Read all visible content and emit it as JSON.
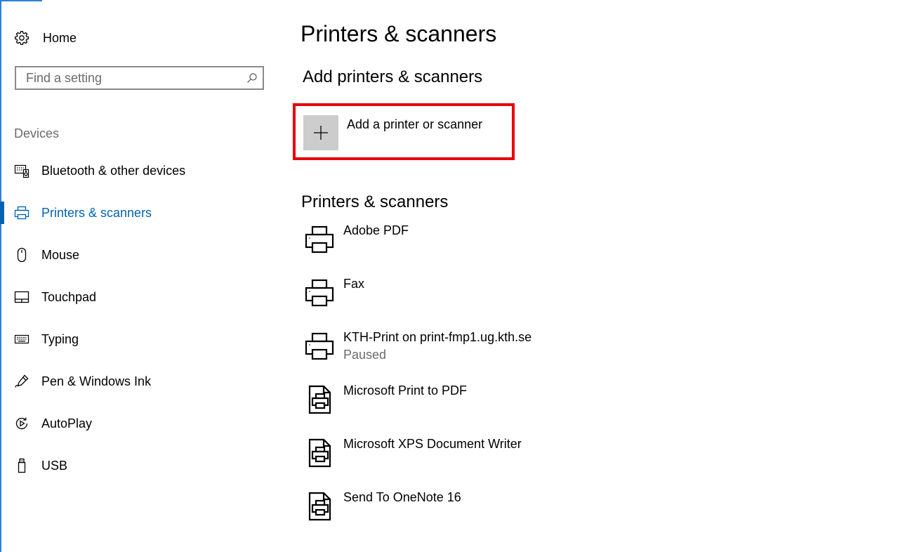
{
  "sidebar": {
    "home_label": "Home",
    "search": {
      "placeholder": "Find a setting"
    },
    "section_label": "Devices",
    "items": [
      {
        "label": "Bluetooth & other devices",
        "icon": "keyboard-speaker-icon"
      },
      {
        "label": "Printers & scanners",
        "icon": "printer-icon",
        "active": true
      },
      {
        "label": "Mouse",
        "icon": "mouse-icon"
      },
      {
        "label": "Touchpad",
        "icon": "touchpad-icon"
      },
      {
        "label": "Typing",
        "icon": "keyboard-icon"
      },
      {
        "label": "Pen & Windows Ink",
        "icon": "pen-icon"
      },
      {
        "label": "AutoPlay",
        "icon": "autoplay-icon"
      },
      {
        "label": "USB",
        "icon": "usb-icon"
      }
    ]
  },
  "main": {
    "title": "Printers & scanners",
    "add_section_title": "Add printers & scanners",
    "add_button_label": "Add a printer or scanner",
    "list_section_title": "Printers & scanners",
    "devices": [
      {
        "name": "Adobe PDF",
        "status": "",
        "icon": "printer-icon"
      },
      {
        "name": "Fax",
        "status": "",
        "icon": "printer-icon"
      },
      {
        "name": "KTH-Print on print-fmp1.ug.kth.se",
        "status": "Paused",
        "icon": "printer-icon"
      },
      {
        "name": "Microsoft Print to PDF",
        "status": "",
        "icon": "document-printer-icon"
      },
      {
        "name": "Microsoft XPS Document Writer",
        "status": "",
        "icon": "document-printer-icon"
      },
      {
        "name": "Send To OneNote 16",
        "status": "",
        "icon": "document-printer-icon"
      }
    ]
  },
  "colors": {
    "accent": "#0063b1",
    "highlight": "#e8000b",
    "edge": "#2b7fd4"
  }
}
